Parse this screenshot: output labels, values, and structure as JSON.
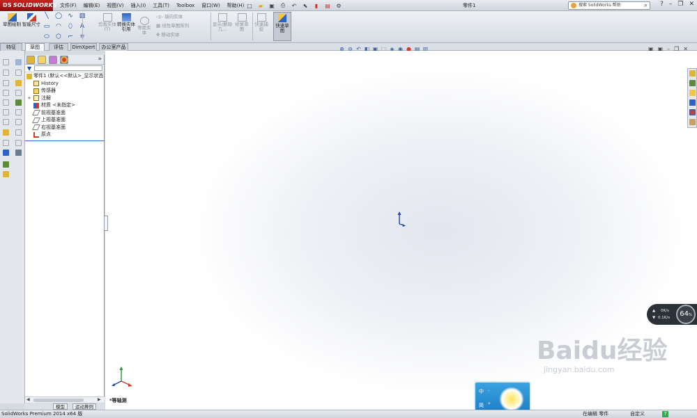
{
  "titlebar": {
    "brand": "SOLIDWORKS",
    "brand_prefix": "DS",
    "menu": [
      "文件(F)",
      "编辑(E)",
      "视图(V)",
      "插入(I)",
      "工具(T)",
      "Toolbox",
      "窗口(W)",
      "帮助(H)"
    ],
    "document_title": "零件1",
    "search_placeholder": "搜索 SolidWorks 帮助"
  },
  "ribbon": {
    "sketch": "草图绘制",
    "smart_dimension": "智能尺寸",
    "trim": "剪裁实体(T)",
    "convert": "转换实体引用",
    "offset": "等距实体",
    "mirror": "镜向实体",
    "linear_pattern": "线性草图阵列",
    "move": "移动实体",
    "display_delete": "显示/删除几...",
    "repair": "修复草图",
    "quick_snap": "快速捕捉",
    "rapid_sketch": "快速草图"
  },
  "tabs": [
    "特征",
    "草图",
    "评估",
    "DimXpert",
    "办公室产品"
  ],
  "feature_tree": {
    "root": "零件1 (默认<<默认>_显示状态",
    "items": [
      "History",
      "传感器",
      "注解",
      "材质 <未指定>",
      "前视基准面",
      "上视基准面",
      "右视基准面",
      "原点"
    ]
  },
  "bottom_tabs": [
    "模型",
    "运动算例"
  ],
  "view": {
    "orientation_label": "*等轴测"
  },
  "network_widget": {
    "upload": "0K/s",
    "download": "0.1K/s",
    "percent": "64",
    "percent_unit": "%"
  },
  "ime": {
    "chars": [
      "中",
      "简"
    ],
    "dots": [
      "·",
      "°"
    ]
  },
  "watermark": {
    "brand": "Baidu经验",
    "url": "jingyan.baidu.com"
  },
  "status": {
    "product": "SolidWorks Premium 2014 x64 版",
    "editing": "在编辑 零件",
    "custom": "自定义",
    "help": "?"
  },
  "colors": {
    "brand_red": "#b81a17",
    "accent_blue": "#2b6bd0"
  }
}
